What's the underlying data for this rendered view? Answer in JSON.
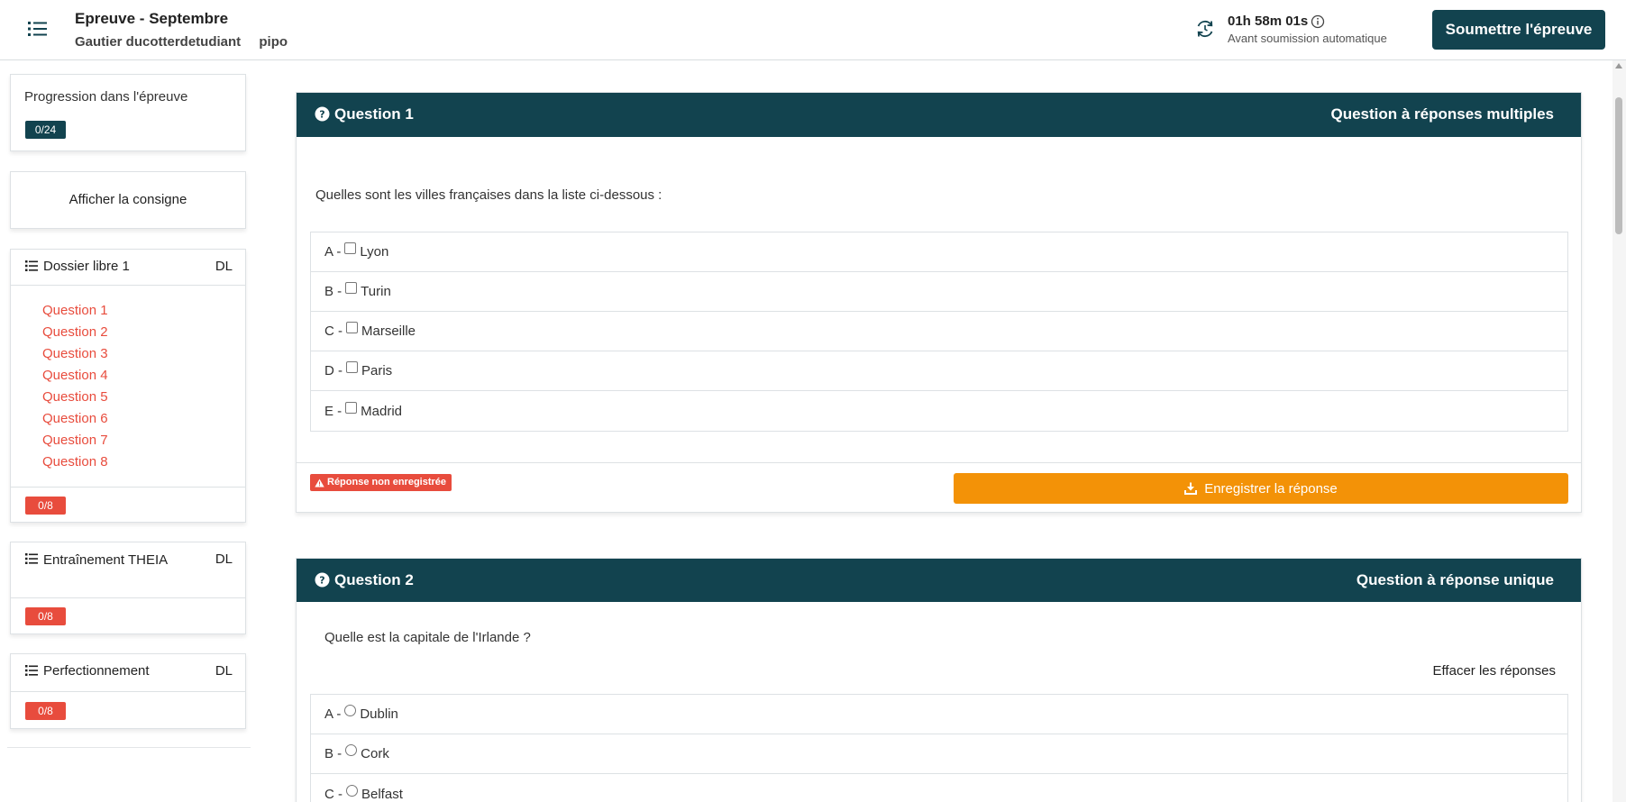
{
  "header": {
    "title": "Epreuve - Septembre",
    "student_name": "Gautier ducotterdetudiant",
    "student_tag": "pipo",
    "timer_value": "01h 58m 01s",
    "timer_label": "Avant soumission automatique",
    "submit_label": "Soumettre l'épreuve"
  },
  "sidebar": {
    "progress_label": "Progression dans l'épreuve",
    "progress_badge": "0/24",
    "consigne_label": "Afficher la consigne",
    "sections": [
      {
        "title": "Dossier libre 1",
        "tag": "DL",
        "questions": [
          "Question 1",
          "Question 2",
          "Question 3",
          "Question 4",
          "Question 5",
          "Question 6",
          "Question 7",
          "Question 8"
        ],
        "badge": "0/8"
      },
      {
        "title": "Entraînement THEIA",
        "tag": "DL",
        "badge": "0/8"
      },
      {
        "title": "Perfectionnement",
        "tag": "DL",
        "badge": "0/8"
      }
    ]
  },
  "questions": [
    {
      "title": "Question 1",
      "type": "Question à réponses multiples",
      "text": "Quelles sont les villes françaises dans la liste ci-dessous :",
      "answers": [
        {
          "letter": "A -",
          "label": "Lyon"
        },
        {
          "letter": "B -",
          "label": "Turin"
        },
        {
          "letter": "C -",
          "label": "Marseille"
        },
        {
          "letter": "D -",
          "label": "Paris"
        },
        {
          "letter": "E -",
          "label": "Madrid"
        }
      ],
      "status": "Réponse non enregistrée",
      "save_label": "Enregistrer la réponse"
    },
    {
      "title": "Question 2",
      "type": "Question à réponse unique",
      "text": "Quelle est la capitale de l'Irlande ?",
      "clear_label": "Effacer les réponses",
      "answers": [
        {
          "letter": "A -",
          "label": "Dublin"
        },
        {
          "letter": "B -",
          "label": "Cork"
        },
        {
          "letter": "C -",
          "label": "Belfast"
        }
      ]
    }
  ],
  "colors": {
    "primary": "#12434f",
    "danger": "#e84c3d",
    "warning": "#f39207"
  }
}
